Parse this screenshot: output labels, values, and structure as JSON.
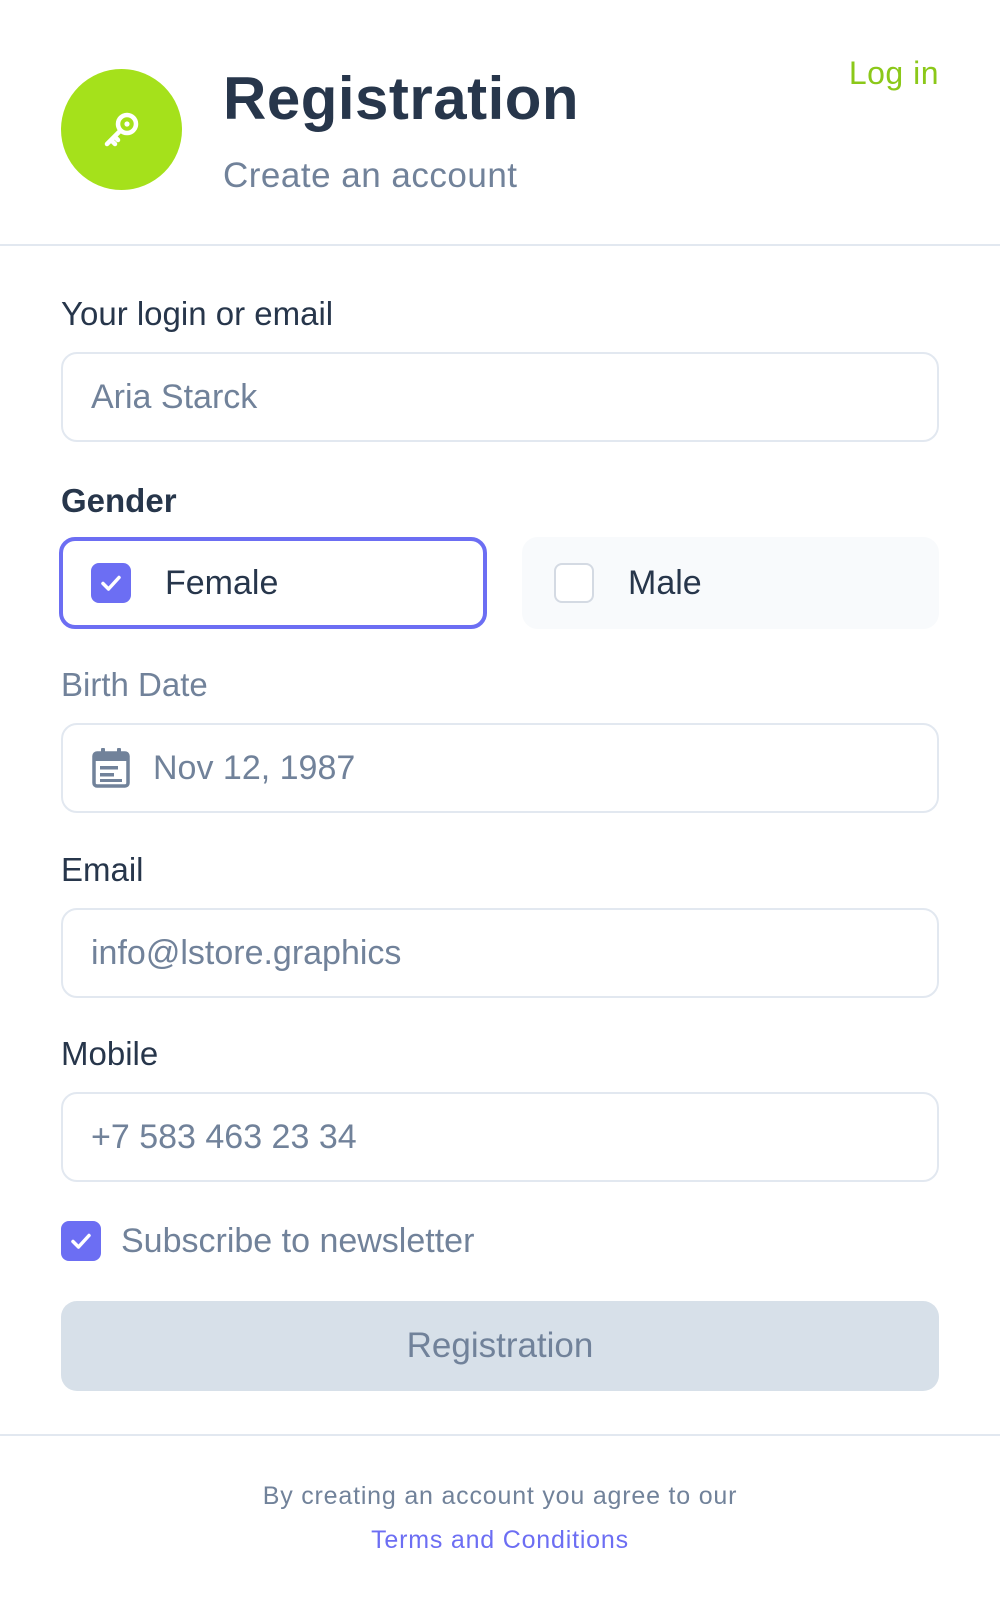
{
  "header": {
    "title": "Registration",
    "subtitle": "Create an account",
    "login_link": "Log in",
    "logo_icon": "key-icon",
    "accent_color": "#a5e11b"
  },
  "form": {
    "login": {
      "label": "Your login or email",
      "value": "Aria Starck"
    },
    "gender": {
      "label": "Gender",
      "options": [
        {
          "label": "Female",
          "checked": true
        },
        {
          "label": "Male",
          "checked": false
        }
      ]
    },
    "birth_date": {
      "label": "Birth Date",
      "value": "Nov 12, 1987",
      "icon": "calendar-icon"
    },
    "email": {
      "label": "Email",
      "value": "info@lstore.graphics"
    },
    "mobile": {
      "label": "Mobile",
      "value": "+7 583 463 23 34"
    },
    "newsletter": {
      "label": "Subscribe to newsletter",
      "checked": true
    },
    "submit_label": "Registration"
  },
  "footer": {
    "note": "By creating an account you agree to our",
    "terms_link": "Terms and Conditions"
  },
  "colors": {
    "primary": "#6c6ef3",
    "text": "#27364b",
    "muted": "#71829a",
    "border": "#e2e8f0"
  }
}
